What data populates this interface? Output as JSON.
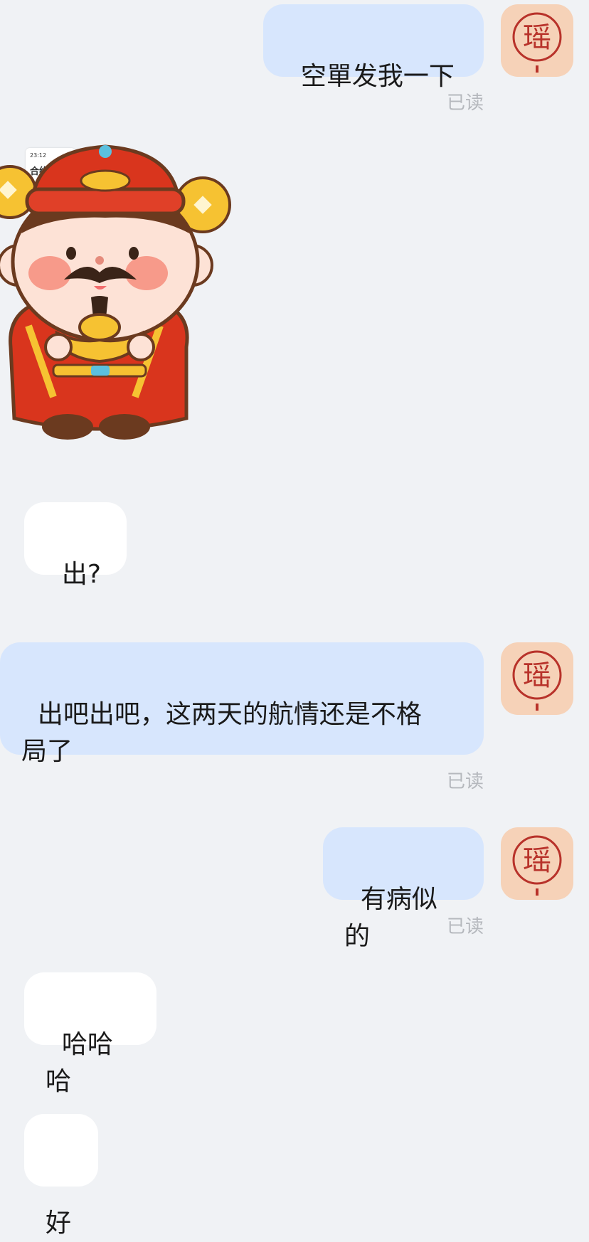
{
  "colors": {
    "background": "#f0f2f5",
    "outgoing_bubble": "#d7e6fd",
    "incoming_bubble": "#ffffff",
    "read_receipt": "#b5b8bd",
    "avatar_bg": "#f6d2b8",
    "avatar_ink": "#b8322a"
  },
  "avatar": {
    "glyph": "瑶",
    "icon": "seal-avatar-icon"
  },
  "sticker": {
    "icon": "god-of-wealth-sticker-icon",
    "thumbnail": {
      "time": "23:12",
      "title": "合约"
    }
  },
  "messages": [
    {
      "direction": "out",
      "text": "空單发我一下",
      "status": "已读"
    },
    {
      "direction": "in",
      "type": "sticker"
    },
    {
      "direction": "in",
      "text": "出?"
    },
    {
      "direction": "out",
      "text": "出吧出吧，这两天的航情还是不格\n局了",
      "status": "已读"
    },
    {
      "direction": "out",
      "text": "有病似的",
      "status": "已读"
    },
    {
      "direction": "in",
      "text": "哈哈哈"
    },
    {
      "direction": "in",
      "text": "好"
    }
  ]
}
